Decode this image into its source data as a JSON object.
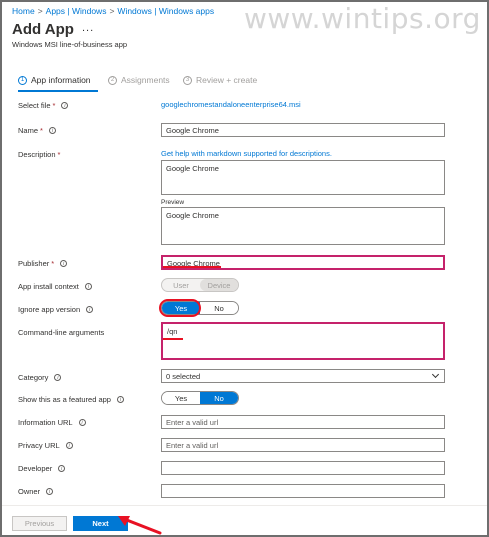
{
  "breadcrumb": {
    "items": [
      "Home",
      "Apps | Windows",
      "Windows | Windows apps"
    ],
    "separator": ">"
  },
  "watermark": "www.wintips.org",
  "header": {
    "title": "Add App",
    "more": "...",
    "subtitle": "Windows MSI line-of-business app"
  },
  "steps": [
    {
      "num": "1",
      "label": "App information",
      "active": true
    },
    {
      "num": "2",
      "label": "Assignments",
      "active": false
    },
    {
      "num": "3",
      "label": "Review + create",
      "active": false
    }
  ],
  "form": {
    "select_file": {
      "label": "Select file",
      "req": "*",
      "value": "googlechromestandaloneenterprise64.msi"
    },
    "name": {
      "label": "Name",
      "req": "*",
      "value": "Google Chrome"
    },
    "description": {
      "label": "Description",
      "req": "*",
      "help_link": "Get help with markdown supported for descriptions.",
      "value": "Google Chrome",
      "preview_label": "Preview",
      "preview_value": "Google Chrome"
    },
    "publisher": {
      "label": "Publisher",
      "req": "*",
      "value": "Google Chrome"
    },
    "install_context": {
      "label": "App install context",
      "options": [
        "User",
        "Device"
      ],
      "selected": "Device"
    },
    "ignore_version": {
      "label": "Ignore app version",
      "options": [
        "Yes",
        "No"
      ],
      "selected": "Yes"
    },
    "cmdline": {
      "label": "Command-line arguments",
      "value": "/qn"
    },
    "category": {
      "label": "Category",
      "value": "0 selected"
    },
    "featured": {
      "label": "Show this as a featured app",
      "options": [
        "Yes",
        "No"
      ],
      "selected": "No"
    },
    "info_url": {
      "label": "Information URL",
      "placeholder": "Enter a valid url"
    },
    "privacy_url": {
      "label": "Privacy URL",
      "placeholder": "Enter a valid url"
    },
    "developer": {
      "label": "Developer",
      "value": ""
    },
    "owner": {
      "label": "Owner",
      "value": ""
    }
  },
  "footer": {
    "previous": "Previous",
    "next": "Next"
  },
  "colors": {
    "accent": "#0078d4",
    "highlight": "#c5226b",
    "annotation": "#e81123"
  }
}
